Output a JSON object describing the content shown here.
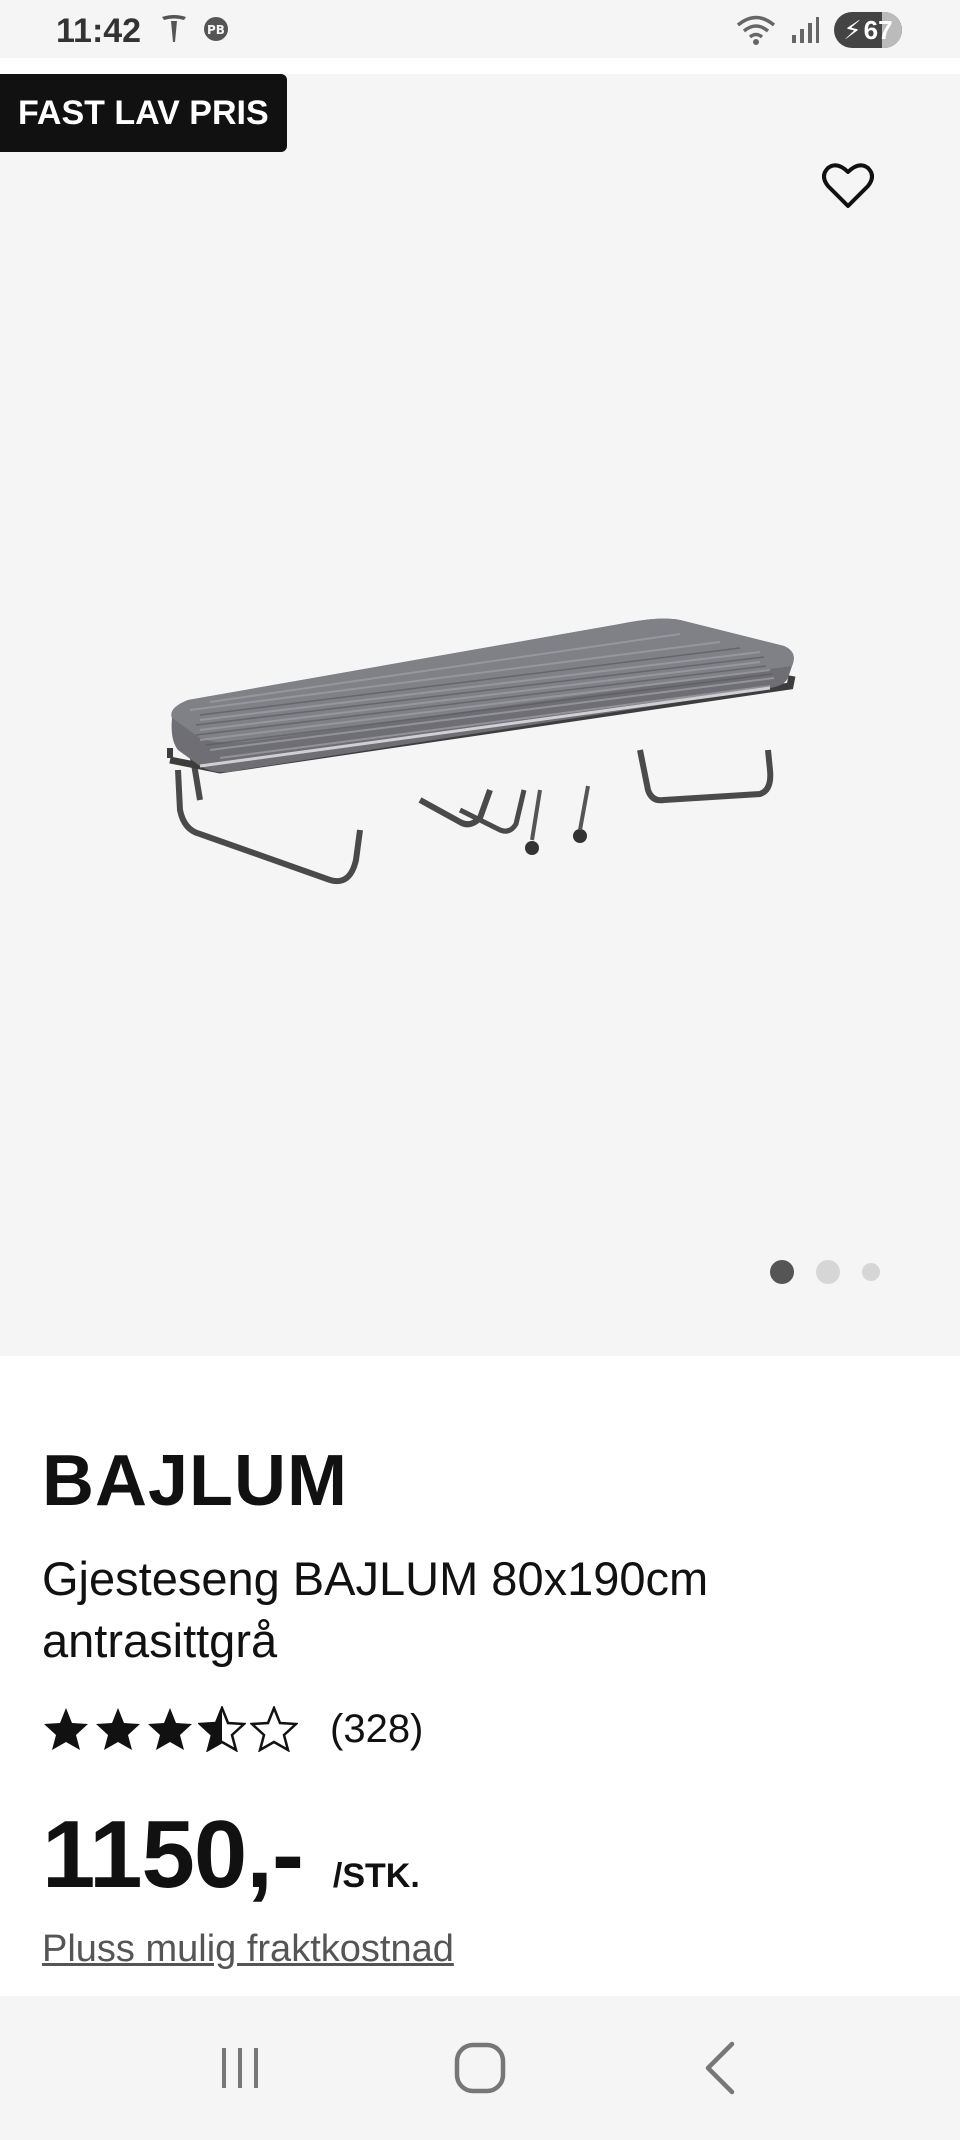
{
  "status_bar": {
    "time": "11:42",
    "battery": "67",
    "icons": [
      "tesla-icon",
      "pb-icon",
      "wifi-icon",
      "signal-icon",
      "battery-charging-icon"
    ]
  },
  "product": {
    "badge": "FAST LAV PRIS",
    "brand": "BAJLUM",
    "subtitle": "Gjesteseng BAJLUM 80x190cm antrasittgrå",
    "rating_value": 3.5,
    "rating_max": 5,
    "rating_count": "(328)",
    "price": "1150,-",
    "unit": "/STK.",
    "shipping_link": "Pluss mulig fraktkostnad",
    "image_count": 3,
    "active_image": 1
  },
  "colors": {
    "background": "#f5f5f5",
    "badge": "#111111",
    "text": "#111111",
    "link": "#555555"
  },
  "navigation": {
    "icons": [
      "recent-apps-icon",
      "home-icon",
      "back-icon"
    ]
  }
}
